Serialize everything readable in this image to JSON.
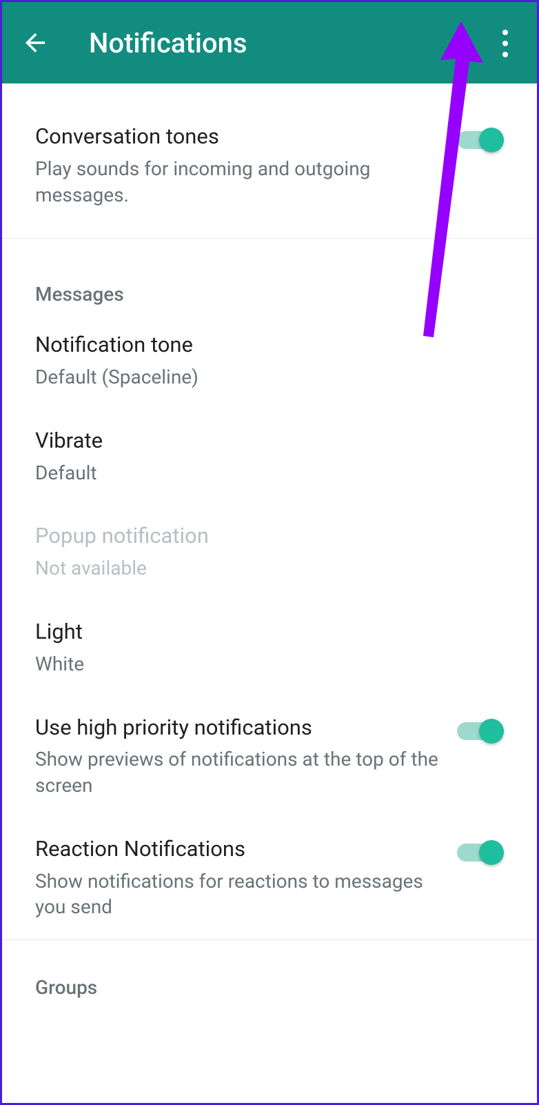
{
  "header": {
    "title": "Notifications"
  },
  "settings": {
    "conversation_tones": {
      "title": "Conversation tones",
      "subtitle": "Play sounds for incoming and outgoing messages."
    }
  },
  "sections": {
    "messages": {
      "header": "Messages",
      "notification_tone": {
        "title": "Notification tone",
        "value": "Default (Spaceline)"
      },
      "vibrate": {
        "title": "Vibrate",
        "value": "Default"
      },
      "popup": {
        "title": "Popup notification",
        "value": "Not available"
      },
      "light": {
        "title": "Light",
        "value": "White"
      },
      "high_priority": {
        "title": "Use high priority notifications",
        "subtitle": "Show previews of notifications at the top of the screen"
      },
      "reaction": {
        "title": "Reaction Notifications",
        "subtitle": "Show notifications for reactions to messages you send"
      }
    },
    "groups": {
      "header": "Groups"
    }
  }
}
